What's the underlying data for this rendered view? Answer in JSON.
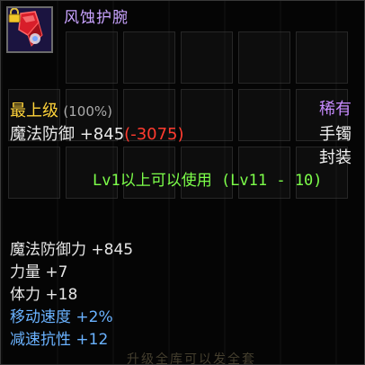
{
  "item": {
    "name": "风蚀护腕",
    "grade_label": "最上级",
    "grade_percent": "(100%)",
    "rarity": "稀有",
    "main_stat": {
      "label": "魔法防御 +845",
      "diff": "(-3075)"
    },
    "slot_type": "手镯",
    "seal_status": "封装",
    "level_requirement": "Lv1以上可以使用 (Lv11 - 10)",
    "stats": [
      "魔法防御力 +845",
      "力量 +7",
      "体力 +18",
      "移动速度 +2%",
      "减速抗性 +12"
    ],
    "footer_text": "升级全库可以发全套"
  },
  "colors": {
    "name": "#c9a3ff",
    "grade": "#ffd33a",
    "rarity": "#c78bff",
    "negative_diff": "#ff3b2f",
    "level_req": "#7dff4a",
    "special_stat": "#6ab2ff",
    "normal_text": "#e6e6e6"
  },
  "icons": {
    "item_icon": "red-bracer-icon",
    "lock_icon": "lock-icon"
  }
}
